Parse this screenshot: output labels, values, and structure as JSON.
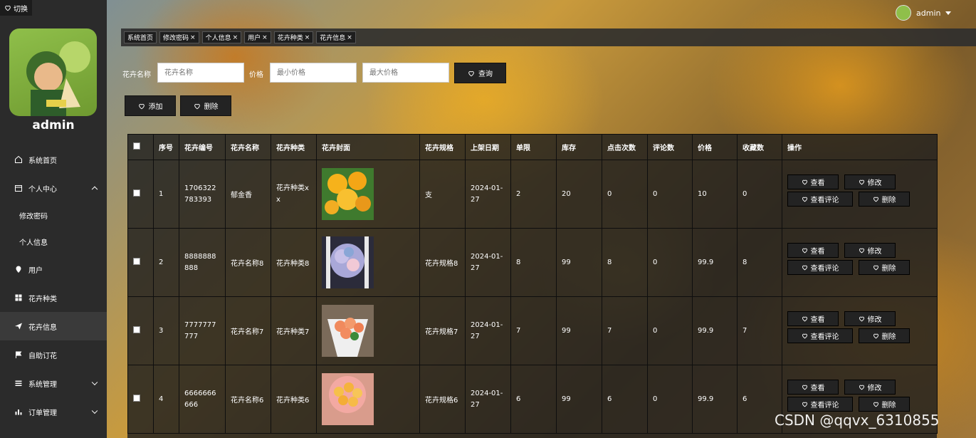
{
  "switch_label": "切换",
  "user": {
    "name": "admin"
  },
  "top_user": {
    "name": "admin"
  },
  "menu": [
    {
      "label": "系统首页",
      "icon": "home-icon"
    },
    {
      "label": "个人中心",
      "icon": "calendar-icon",
      "expanded": true
    },
    {
      "label": "修改密码",
      "sub": true
    },
    {
      "label": "个人信息",
      "sub": true
    },
    {
      "label": "用户",
      "icon": "location-pin-icon"
    },
    {
      "label": "花卉种类",
      "icon": "grid-icon"
    },
    {
      "label": "花卉信息",
      "icon": "paper-plane-icon",
      "active": true
    },
    {
      "label": "自助订花",
      "icon": "flag-icon"
    },
    {
      "label": "系统管理",
      "icon": "menu-lines-icon",
      "collapsed": true
    },
    {
      "label": "订单管理",
      "icon": "bar-chart-icon",
      "collapsed": true
    }
  ],
  "tabs": [
    "系统首页",
    "修改密码",
    "个人信息",
    "用户",
    "花卉种类",
    "花卉信息"
  ],
  "search": {
    "name_label": "花卉名称",
    "name_placeholder": "花卉名称",
    "price_label": "价格",
    "min_placeholder": "最小价格",
    "max_placeholder": "最大价格",
    "query_label": "查询"
  },
  "actions": {
    "add_label": "添加",
    "delete_label": "删除"
  },
  "table": {
    "headers": [
      "序号",
      "花卉编号",
      "花卉名称",
      "花卉种类",
      "花卉封面",
      "花卉规格",
      "上架日期",
      "单限",
      "库存",
      "点击次数",
      "评论数",
      "价格",
      "收藏数",
      "操作"
    ],
    "rows": [
      {
        "idx": "1",
        "code": "1706322783393",
        "name": "郁金香",
        "type": "花卉种类xx",
        "spec": "支",
        "date": "2024-01-27",
        "limit": "2",
        "stock": "20",
        "clicks": "0",
        "comments": "0",
        "price": "10",
        "favs": "0"
      },
      {
        "idx": "2",
        "code": "8888888888",
        "name": "花卉名称8",
        "type": "花卉种类8",
        "spec": "花卉规格8",
        "date": "2024-01-27",
        "limit": "8",
        "stock": "99",
        "clicks": "8",
        "comments": "0",
        "price": "99.9",
        "favs": "8"
      },
      {
        "idx": "3",
        "code": "7777777777",
        "name": "花卉名称7",
        "type": "花卉种类7",
        "spec": "花卉规格7",
        "date": "2024-01-27",
        "limit": "7",
        "stock": "99",
        "clicks": "7",
        "comments": "0",
        "price": "99.9",
        "favs": "7"
      },
      {
        "idx": "4",
        "code": "6666666666",
        "name": "花卉名称6",
        "type": "花卉种类6",
        "spec": "花卉规格6",
        "date": "2024-01-27",
        "limit": "6",
        "stock": "99",
        "clicks": "6",
        "comments": "0",
        "price": "99.9",
        "favs": "6"
      }
    ],
    "ops": {
      "view": "查看",
      "edit": "修改",
      "view_comments": "查看评论",
      "delete": "删除"
    }
  },
  "watermark": "CSDN @qqvx_6310855"
}
